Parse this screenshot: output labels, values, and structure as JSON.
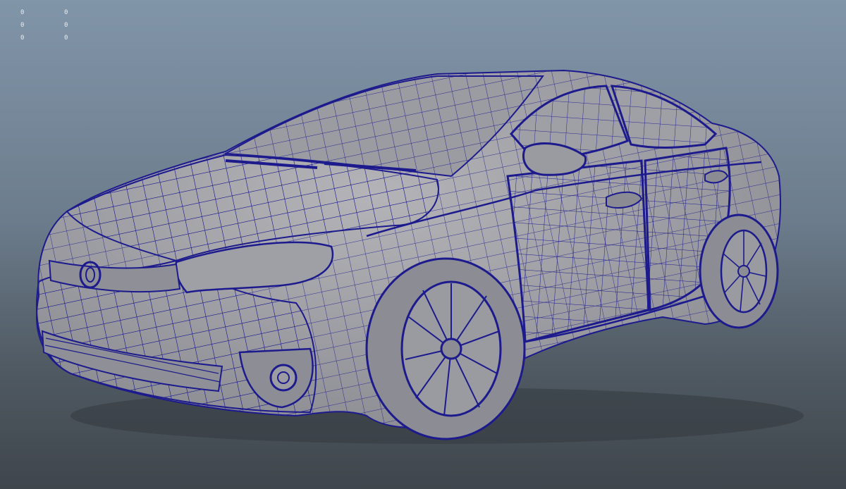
{
  "viewport": {
    "hud_values": [
      [
        "0",
        "0"
      ],
      [
        "0",
        "0"
      ],
      [
        "0",
        "0"
      ]
    ]
  },
  "colors": {
    "wire": "#1c1a8c",
    "surface": "#a7a7ab",
    "surface_dark": "#7f8087"
  }
}
